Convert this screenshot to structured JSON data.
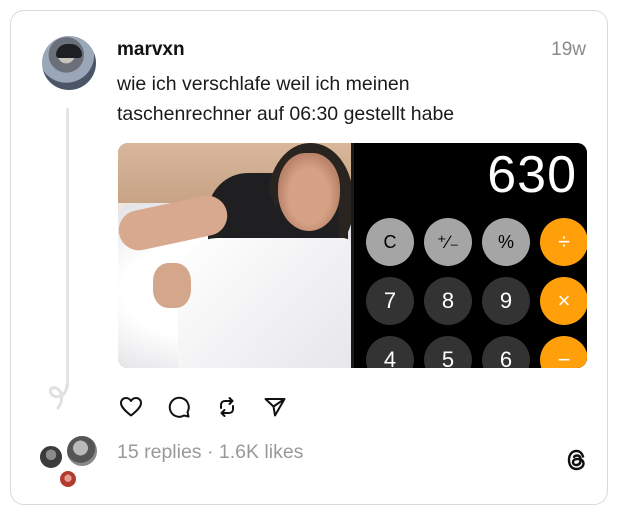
{
  "post": {
    "username": "marvxn",
    "time": "19w",
    "caption": "wie ich verschlafe weil ich meinen taschenrechner auf 06:30 gestellt habe"
  },
  "media": {
    "calculator": {
      "display": "630",
      "keys": [
        {
          "label": "C",
          "kind": "func"
        },
        {
          "label": "⁺∕₋",
          "kind": "func"
        },
        {
          "label": "%",
          "kind": "func"
        },
        {
          "label": "÷",
          "kind": "op"
        },
        {
          "label": "7",
          "kind": "num"
        },
        {
          "label": "8",
          "kind": "num"
        },
        {
          "label": "9",
          "kind": "num"
        },
        {
          "label": "×",
          "kind": "op"
        },
        {
          "label": "4",
          "kind": "num"
        },
        {
          "label": "5",
          "kind": "num"
        },
        {
          "label": "6",
          "kind": "num"
        },
        {
          "label": "−",
          "kind": "op"
        }
      ]
    }
  },
  "actions": [
    {
      "name": "like-button",
      "icon": "heart-icon"
    },
    {
      "name": "reply-button",
      "icon": "comment-icon"
    },
    {
      "name": "repost-button",
      "icon": "repost-icon"
    },
    {
      "name": "share-button",
      "icon": "send-icon"
    }
  ],
  "footer": {
    "stats": "15 replies · 1.6K likes",
    "logo": "threads-icon"
  },
  "colors": {
    "operator": "#ff9f0a",
    "function_key": "#a5a5a5",
    "number_key": "#333333",
    "muted_text": "#999999"
  }
}
